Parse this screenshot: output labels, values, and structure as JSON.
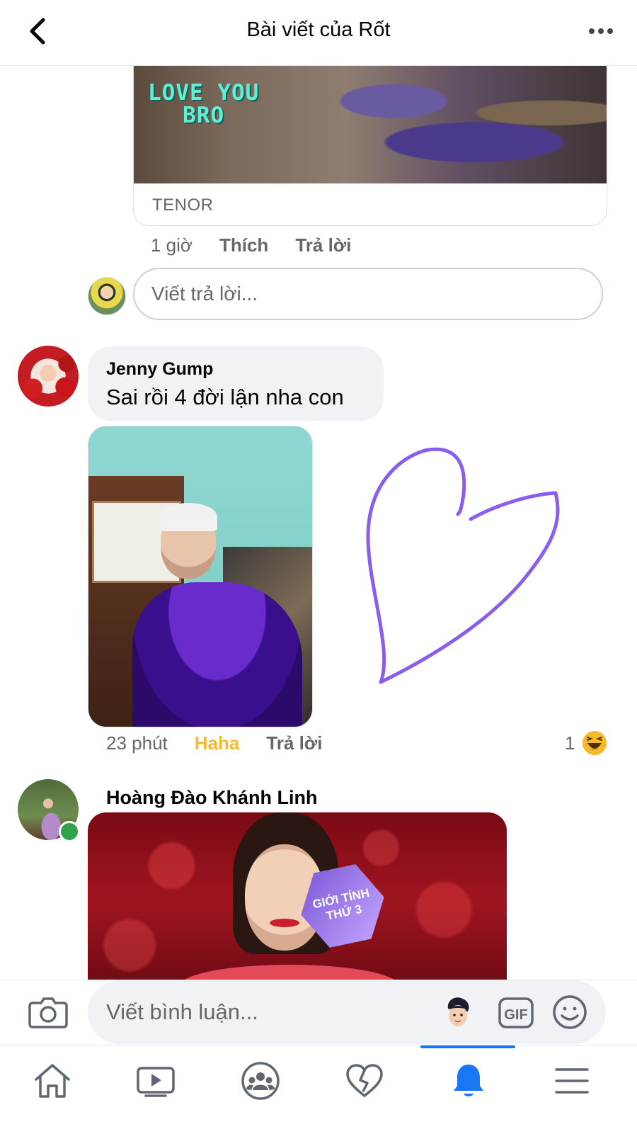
{
  "header": {
    "title": "Bài viết của Rốt"
  },
  "gif_attachment": {
    "overlay_text_line1": "LOVE YOU",
    "overlay_text_line2": "BRO",
    "source": "TENOR"
  },
  "previous_comment_meta": {
    "time": "1 giờ",
    "like": "Thích",
    "reply": "Trả lời"
  },
  "reply_box": {
    "placeholder": "Viết trả lời..."
  },
  "comments": [
    {
      "author": "Jenny Gump",
      "text": "Sai rồi 4 đời lận nha con",
      "time": "23 phút",
      "reaction_label": "Haha",
      "reply": "Trả lời",
      "reaction_count": "1",
      "reaction_icon": "haha-emoji-icon",
      "reaction_color": "#f7b928"
    },
    {
      "author": "Hoàng Đào Khánh Linh",
      "online": true,
      "image_badge_line1": "GIỚI TÍNH",
      "image_badge_line2": "THỨ 3"
    }
  ],
  "composer": {
    "placeholder": "Viết bình luận..."
  },
  "colors": {
    "accent": "#1877f2",
    "online": "#31a24c",
    "heart_sticker": "#8a5cf0"
  },
  "bottom_nav": {
    "items": [
      "home-icon",
      "watch-icon",
      "groups-icon",
      "dating-icon",
      "notifications-icon",
      "menu-icon"
    ],
    "active": "notifications-icon"
  }
}
